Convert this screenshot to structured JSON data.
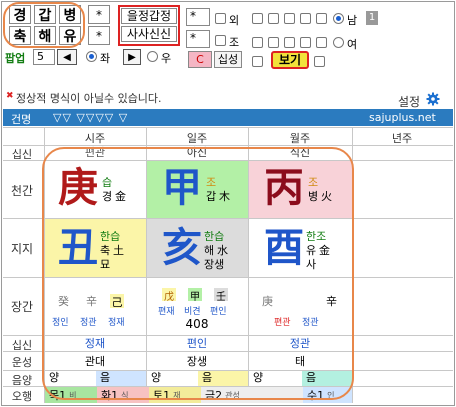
{
  "top": {
    "pillars_row1": [
      "경",
      "갑",
      "병",
      "*"
    ],
    "pillars_row2": [
      "축",
      "해",
      "유",
      "*"
    ],
    "name_label": "팝업",
    "number_value": "5",
    "prev_glyph": "◀",
    "radio_left_label": "좌",
    "play_glyph": "▶",
    "radio_right_label": "우",
    "ganji_top": "을정갑정",
    "ganji_bottom": "사사신신",
    "star1": "*",
    "star2": "*",
    "oe_label": "외",
    "jo_label": "조",
    "c_label": "C",
    "sipsung_label": "십성",
    "nam_label": "남",
    "nam_badge": "1",
    "yeo_label": "여",
    "bogi_label": "보기"
  },
  "notice": {
    "star": "✖",
    "text": "정상적 명식이 아닐수 있습니다.",
    "settings_label": "설정"
  },
  "header": {
    "geonmyeong": "건명",
    "triangles": "▽▽ ▽▽▽▽ ▽",
    "site": "sajuplus.net"
  },
  "columns": {
    "sisu": "시주",
    "ilju": "일주",
    "wolju": "월주",
    "yeonju": "년주"
  },
  "rows": {
    "sipsin_top": "십신",
    "cheongan": "천간",
    "jiji": "지지",
    "janggan": "장간",
    "sipsin_bottom": "십신",
    "unseong": "운성",
    "eumyang": "음양",
    "ohaeng": "오행"
  },
  "sipsin_top": {
    "si": "편관",
    "il": "아신",
    "wol": "식신"
  },
  "cheongan": {
    "si": {
      "char": "庚",
      "han": "습",
      "kor": "경",
      "elem": "金",
      "han_label": ""
    },
    "il": {
      "char": "甲",
      "tag": "조",
      "kor": "갑",
      "elem": "木"
    },
    "wol": {
      "char": "丙",
      "tag": "조",
      "kor": "병",
      "elem": "火"
    }
  },
  "jiji": {
    "si": {
      "char": "丑",
      "han": "한습",
      "kor": "축",
      "elem": "土",
      "sub": "묘"
    },
    "il": {
      "char": "亥",
      "han": "한습",
      "kor": "해",
      "elem": "水",
      "sub": "장생"
    },
    "wol": {
      "char": "酉",
      "han": "한조",
      "kor": "유",
      "elem": "金",
      "sub": "사"
    }
  },
  "janggan": {
    "si_chars": [
      "癸",
      "辛",
      "己"
    ],
    "si_labels": [
      "정인",
      "정관",
      "정재"
    ],
    "il_chars": [
      "戊",
      "甲",
      "壬"
    ],
    "il_labels": [
      "편재",
      "비견",
      "편인"
    ],
    "il_number": "408",
    "wol_chars": [
      "庚",
      "辛"
    ],
    "wol_labels": [
      "편관",
      "정관"
    ]
  },
  "sipsin_bottom": {
    "si": "정재",
    "il": "편인",
    "wol": "정관"
  },
  "unseong": {
    "si": "관대",
    "il": "장생",
    "wol": "태"
  },
  "eumyang": [
    "양",
    "음",
    "양",
    "음",
    "양",
    "음"
  ],
  "ohaeng": [
    {
      "label": "목1",
      "sub": "비",
      "color": "#a8e6a0"
    },
    {
      "label": "화1",
      "sub": "식",
      "color": "#f7c2c2"
    },
    {
      "label": "토1",
      "sub": "재",
      "color": "#f3ec9a"
    },
    {
      "label": "금2",
      "sub": "관성",
      "color": "#eeeeee"
    },
    {
      "label": "수1",
      "sub": "인",
      "color": "#cfe4ff"
    }
  ],
  "colors": {
    "header_blue": "#2b7bbf",
    "ring_orange": "#e8874a",
    "green_cell": "#b3f0a6",
    "pink_cell": "#f8d2d8",
    "yellow_cell": "#fbf5a8",
    "gray_cell": "#dcdcdc",
    "white_cell": "#ffffff",
    "bogi_yellow": "#f2e13a"
  }
}
